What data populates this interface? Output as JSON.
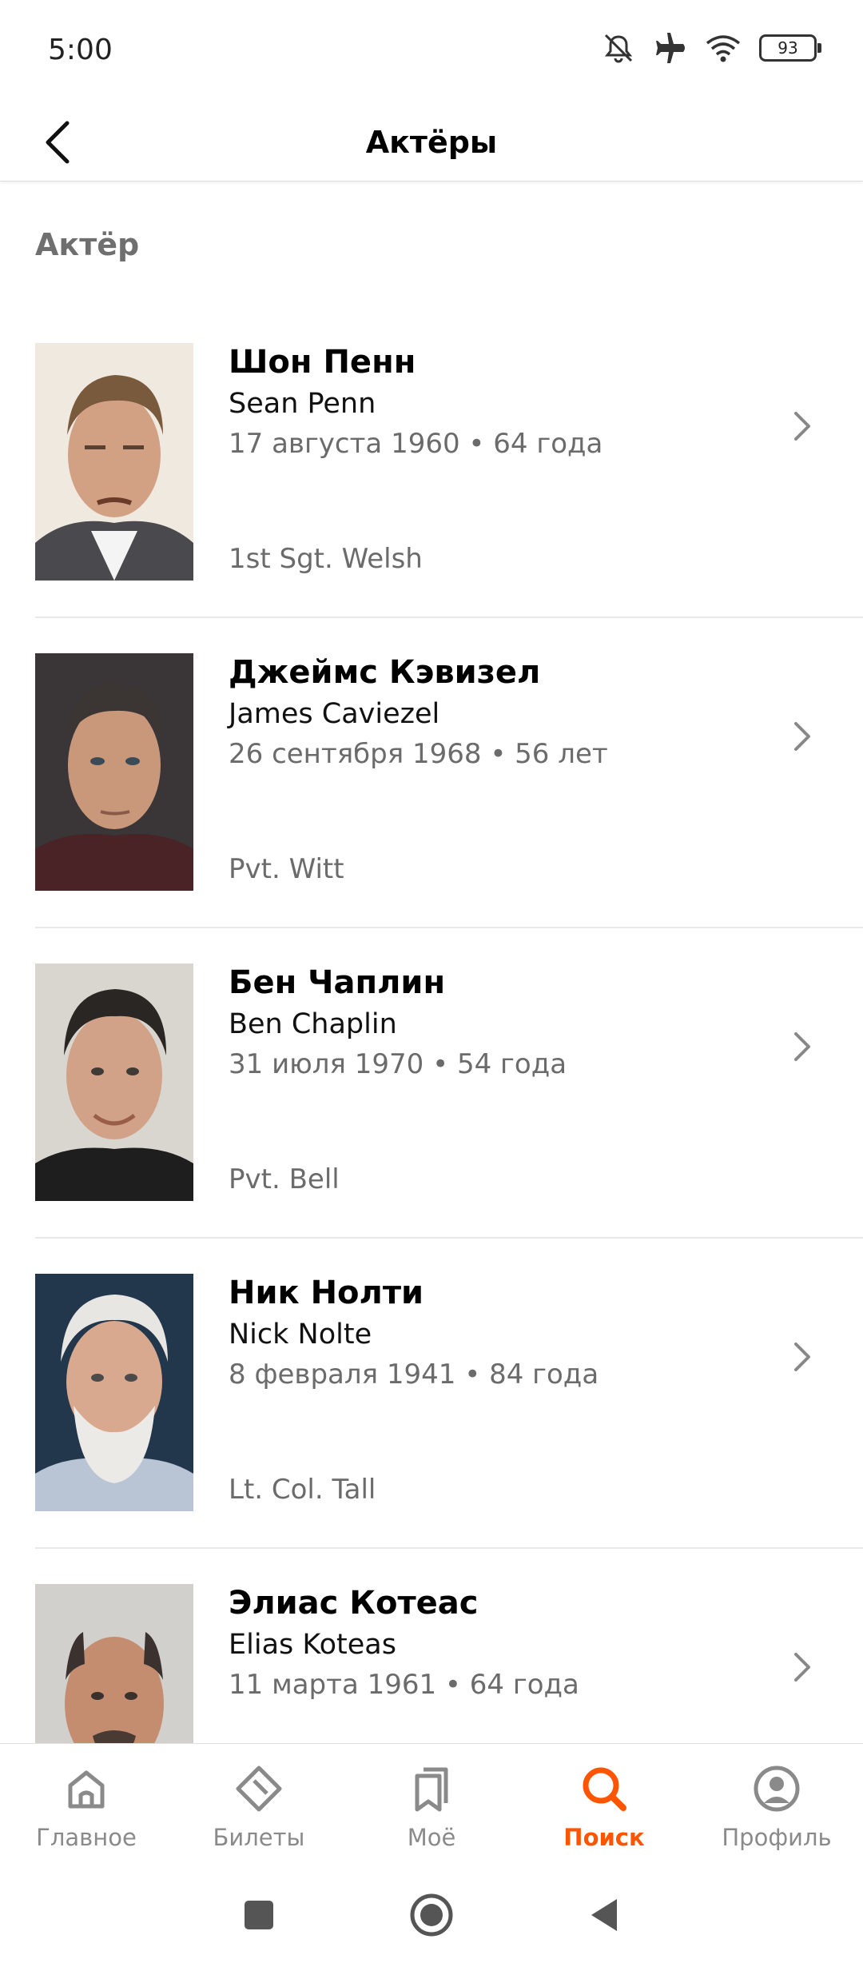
{
  "status_bar": {
    "time": "5:00",
    "battery": "93",
    "icons": [
      "mute-icon",
      "airplane-icon",
      "wifi-icon",
      "battery-icon"
    ]
  },
  "header": {
    "title": "Актёры",
    "back_icon": "chevron-left-icon"
  },
  "section": {
    "title": "Актёр"
  },
  "actors": [
    {
      "name": "Шон Пенн",
      "original_name": "Sean Penn",
      "dates": "17 августа 1960 • 64 года",
      "role": "1st Sgt. Welsh"
    },
    {
      "name": "Джеймс Кэвизел",
      "original_name": "James Caviezel",
      "dates": "26 сентября 1968 • 56 лет",
      "role": "Pvt. Witt"
    },
    {
      "name": "Бен Чаплин",
      "original_name": "Ben Chaplin",
      "dates": "31 июля 1970 • 54 года",
      "role": "Pvt. Bell"
    },
    {
      "name": "Ник Нолти",
      "original_name": "Nick Nolte",
      "dates": "8 февраля 1941 • 84 года",
      "role": "Lt. Col. Tall"
    },
    {
      "name": "Элиас Котеас",
      "original_name": "Elias Koteas",
      "dates": "11 марта 1961 • 64 года",
      "role": ""
    }
  ],
  "bottom_nav": [
    {
      "label": "Главное",
      "icon": "home-icon",
      "active": false
    },
    {
      "label": "Билеты",
      "icon": "ticket-icon",
      "active": false
    },
    {
      "label": "Моё",
      "icon": "bookmark-icon",
      "active": false
    },
    {
      "label": "Поиск",
      "icon": "search-icon",
      "active": true
    },
    {
      "label": "Профиль",
      "icon": "profile-icon",
      "active": false
    }
  ],
  "colors": {
    "accent": "#ff5500",
    "secondary_text": "#6b6b6b",
    "inactive_nav": "#8a8a8a"
  }
}
